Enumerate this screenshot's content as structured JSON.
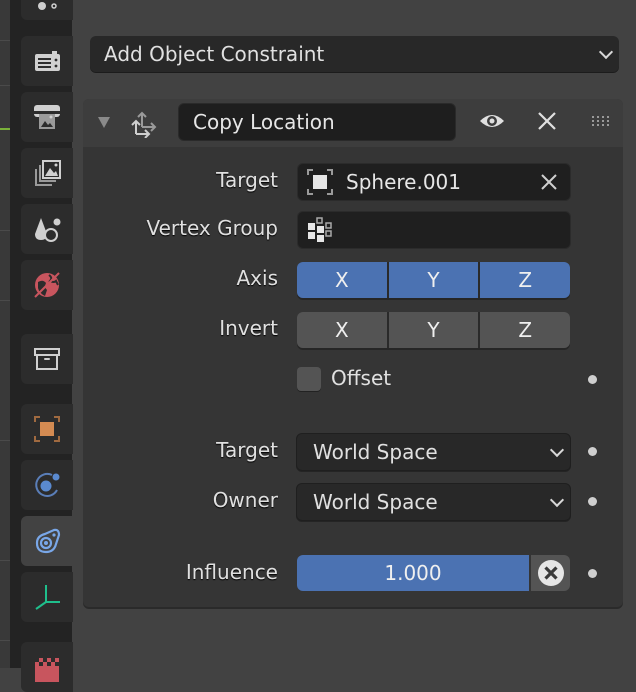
{
  "properties_tabs": [
    {
      "name": "render-tab",
      "icon": "camera-back-icon"
    },
    {
      "name": "output-tab",
      "icon": "printer-icon"
    },
    {
      "name": "view-layer-tab",
      "icon": "image-stack-icon"
    },
    {
      "name": "scene-tab",
      "icon": "scene-icon"
    },
    {
      "name": "world-tab",
      "icon": "world-icon"
    },
    {
      "name": "collection-tab",
      "icon": "box-icon"
    },
    {
      "name": "object-tab",
      "icon": "object-square-icon"
    },
    {
      "name": "physics-tab",
      "icon": "physics-icon"
    },
    {
      "name": "constraints-tab",
      "icon": "object-constraint-icon",
      "active": true
    },
    {
      "name": "object-data-tab",
      "icon": "empty-axes-icon"
    },
    {
      "name": "texture-tab",
      "icon": "checker-icon"
    }
  ],
  "add_constraint": {
    "label": "Add Object Constraint"
  },
  "constraint": {
    "name": "Copy Location",
    "target_label": "Target",
    "target_value": "Sphere.001",
    "vertex_group_label": "Vertex Group",
    "vertex_group_value": "",
    "axis_label": "Axis",
    "axis": [
      {
        "label": "X",
        "on": true
      },
      {
        "label": "Y",
        "on": true
      },
      {
        "label": "Z",
        "on": true
      }
    ],
    "invert_label": "Invert",
    "invert": [
      {
        "label": "X",
        "on": false
      },
      {
        "label": "Y",
        "on": false
      },
      {
        "label": "Z",
        "on": false
      }
    ],
    "offset_label": "Offset",
    "offset_checked": false,
    "target_space_label": "Target",
    "target_space": "World Space",
    "owner_space_label": "Owner",
    "owner_space": "World Space",
    "influence_label": "Influence",
    "influence": "1.000"
  },
  "colors": {
    "accent": "#4b72b2",
    "panel": "#353535",
    "background": "#424242"
  }
}
